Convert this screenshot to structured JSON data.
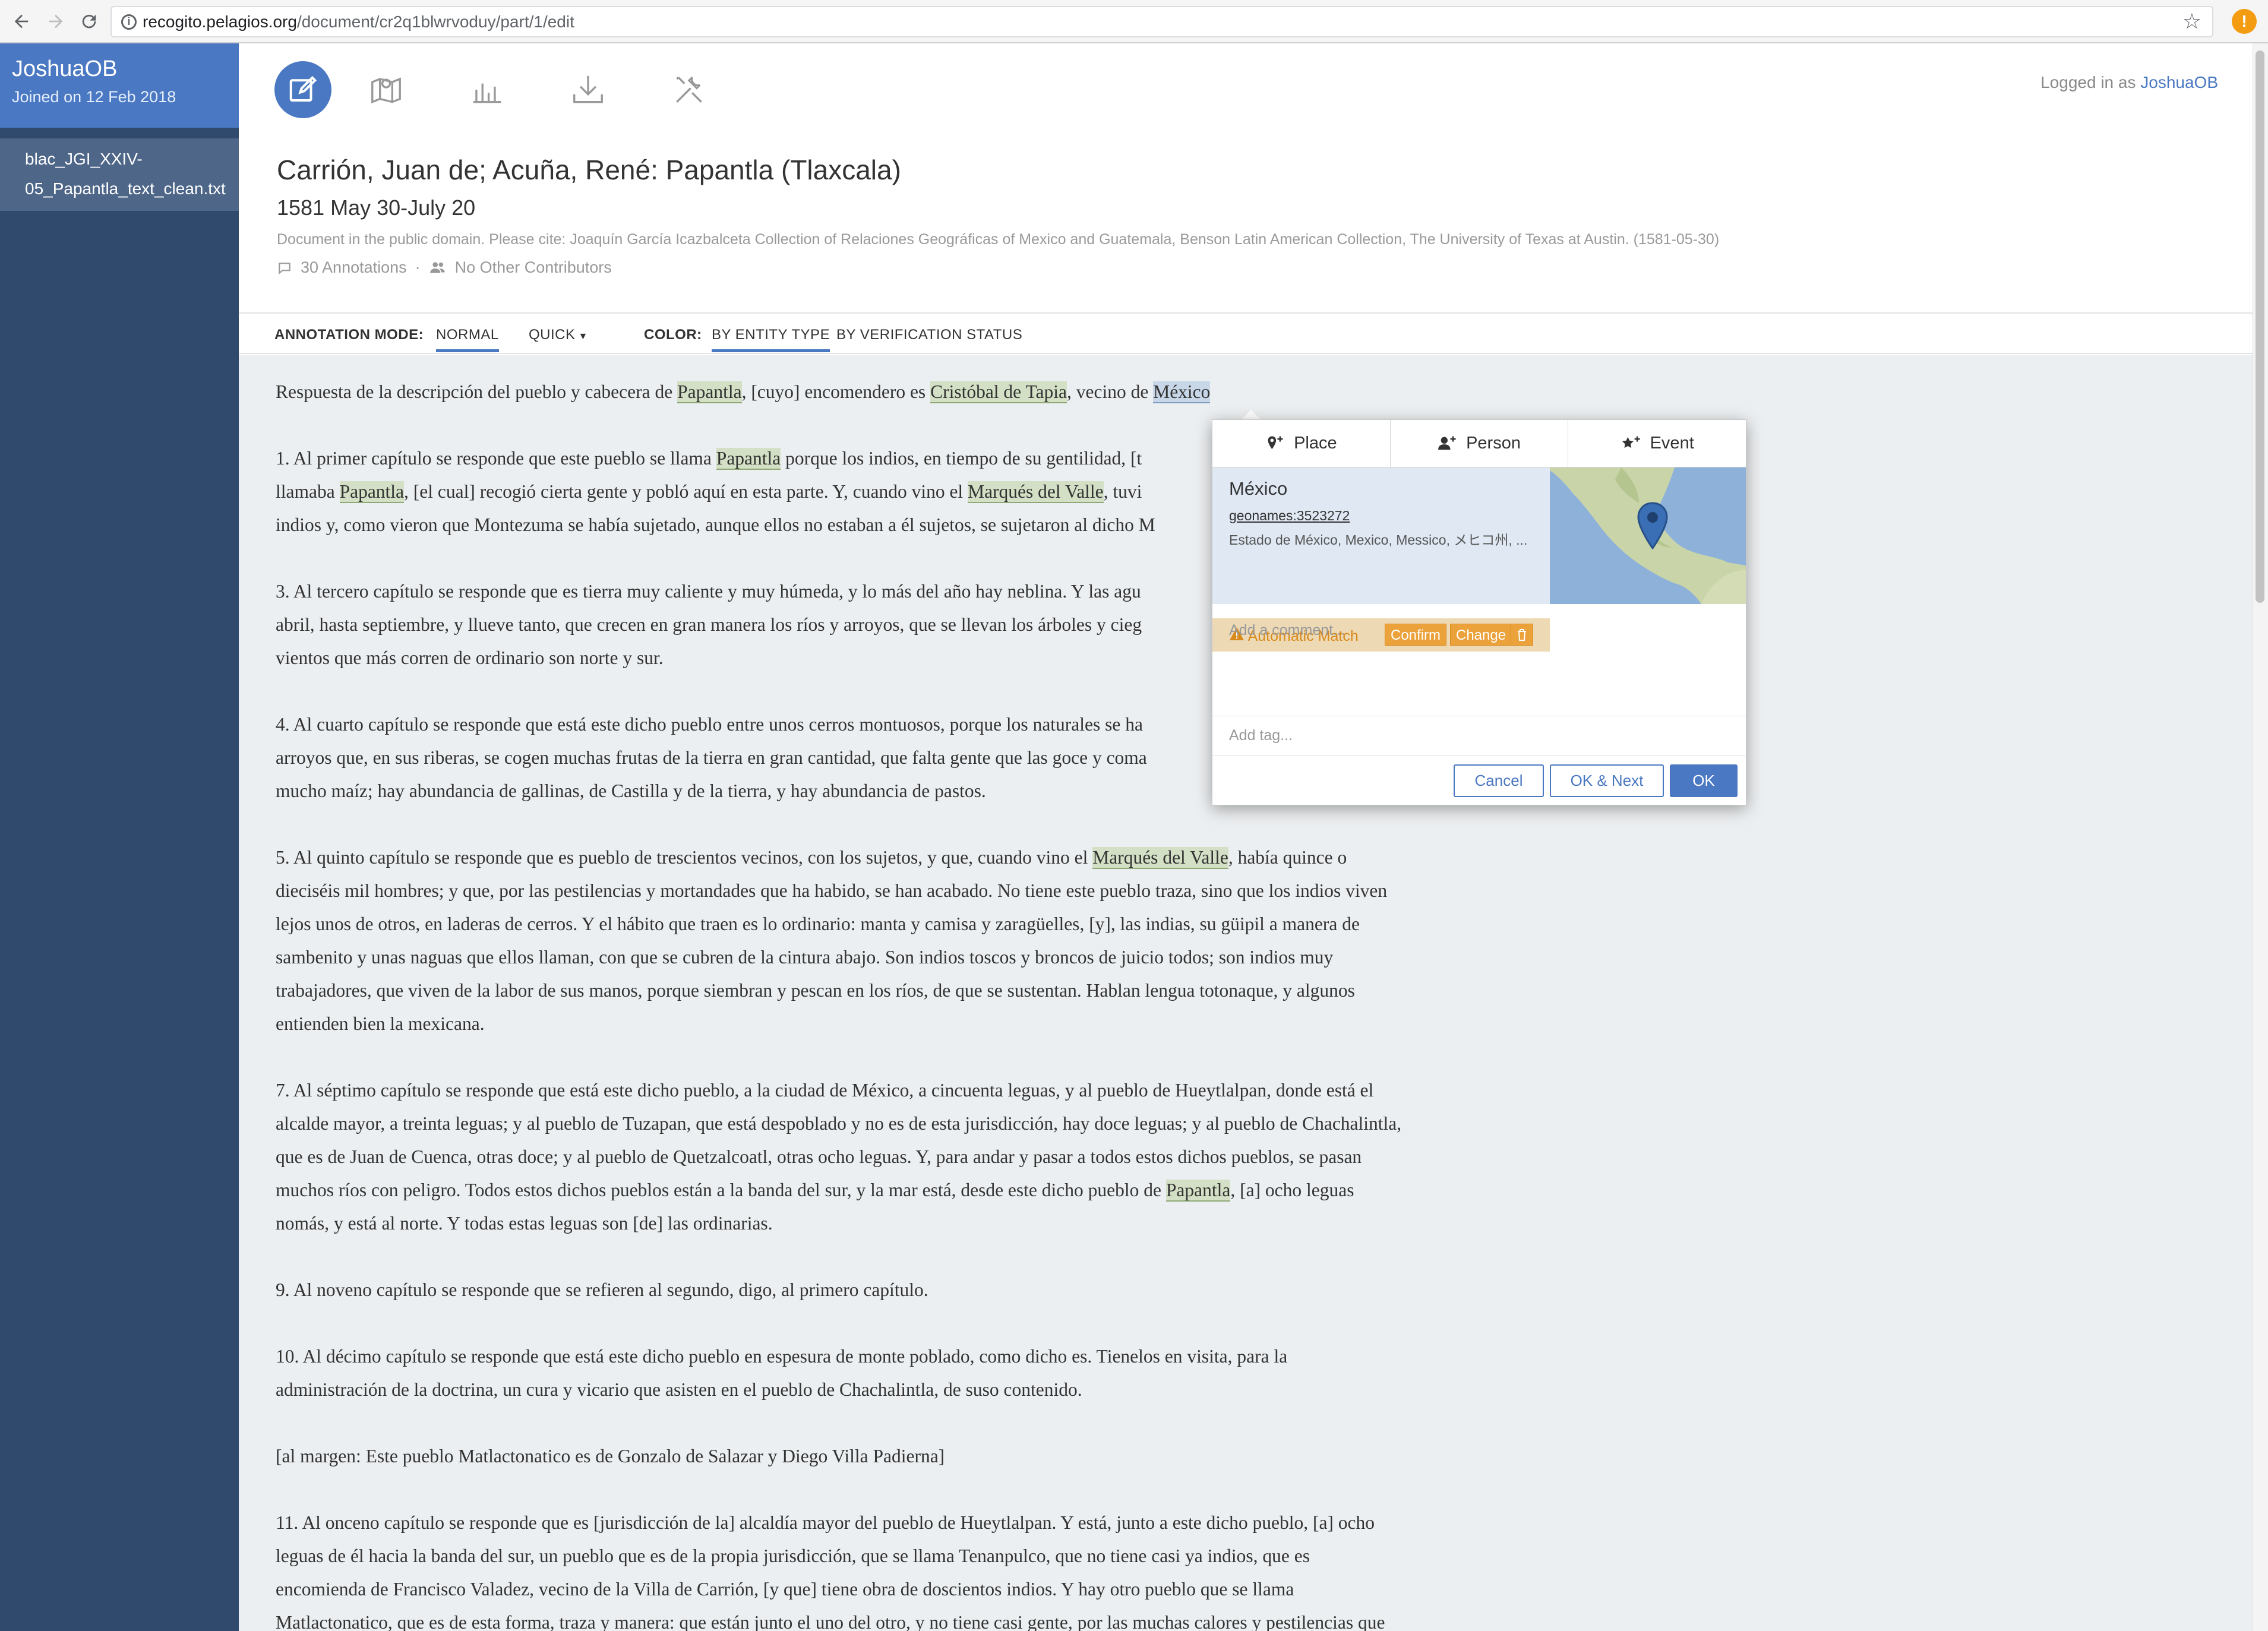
{
  "browser": {
    "url_host": "recogito.pelagios.org",
    "url_path": "/document/cr2q1blwrvoduy/part/1/edit",
    "back_icon": "arrow-left-icon",
    "forward_icon": "arrow-right-icon",
    "reload_icon": "reload-icon",
    "bookmark_icon": "star-icon",
    "extension_icon": "alert-icon",
    "extension_glyph": "!"
  },
  "sidebar": {
    "user_name": "JoshuaOB",
    "joined": "Joined on 12 Feb 2018",
    "documents": [
      {
        "line1": "blac_JGI_XXIV-",
        "line2": "05_Papantla_text_clean.txt"
      }
    ]
  },
  "header": {
    "tools": [
      "edit-icon",
      "map-icon",
      "stats-icon",
      "download-icon",
      "settings-icon"
    ],
    "logged_in_prefix": "Logged in as",
    "logged_in_user": "JoshuaOB",
    "title": "Carrión, Juan de; Acuña, René: Papantla (Tlaxcala)",
    "date": "1581 May 30-July 20",
    "citation": "Document in the public domain. Please cite: Joaquín García Icazbalceta Collection of Relaciones Geográficas of Mexico and Guatemala, Benson Latin American Collection, The University of Texas at Austin. (1581-05-30)",
    "annotations": "30 Annotations",
    "separator": "·",
    "contributors": "No Other Contributors"
  },
  "toolbar": {
    "mode_label": "ANNOTATION MODE:",
    "mode_normal": "NORMAL",
    "mode_quick": "QUICK",
    "color_label": "COLOR:",
    "color_entity": "BY ENTITY TYPE",
    "color_verification": "BY VERIFICATION STATUS"
  },
  "text": {
    "p0": [
      "Respuesta de la descripción del pueblo y cabecera de ",
      "Papantla",
      ", [cuyo] encomendero es ",
      "Cristóbal de Tapia",
      ", vecino de ",
      "México"
    ],
    "p1a": [
      "1. Al primer capítulo se responde que este pueblo se llama ",
      "Papantla",
      " porque los indios, en tiempo de su gentilidad, [t"
    ],
    "p1b": [
      "llamaba ",
      "Papantla",
      ", [el cual] recogió cierta gente y pobló aquí en esta parte. Y, cuando vino el ",
      "Marqués del Valle",
      ", tuvi"
    ],
    "p1c": "indios y, como vieron que Montezuma se había sujetado, aunque ellos no estaban a él sujetos, se sujetaron al dicho M",
    "p3": [
      "3. Al tercero capítulo se responde que es tierra muy caliente y muy húmeda, y lo más del año hay neblina. Y las agu",
      "abril, hasta septiembre, y llueve tanto, que crecen en gran manera los ríos y arroyos, que se llevan los árboles y cieg",
      "vientos que más corren de ordinario son norte y sur."
    ],
    "p4": [
      "4. Al cuarto capítulo se responde que está este dicho pueblo entre unos cerros montuosos, porque los naturales se ha",
      "arroyos que, en sus riberas, se cogen muchas frutas de la tierra en gran cantidad, que falta gente que las goce y coma",
      "mucho maíz; hay abundancia de gallinas, de Castilla y de la tierra, y hay abundancia de pastos."
    ],
    "p5a": [
      "5. Al quinto capítulo se responde que es pueblo de trescientos vecinos, con los sujetos, y que, cuando vino el ",
      "Marqués del Valle",
      ", había quince o"
    ],
    "p5": [
      "dieciséis mil hombres; y que, por las pestilencias y mortandades que ha habido, se han acabado. No tiene este pueblo traza, sino que los indios viven",
      "lejos unos de otros, en laderas de cerros. Y el hábito que traen es lo ordinario: manta y camisa y zaragüelles, [y], las indias, su güipil a manera de",
      "sambenito y unas naguas que ellos llaman, con que se cubren de la cintura abajo. Son indios toscos y broncos de juicio todos; son indios muy",
      "trabajadores, que viven de la labor de sus manos, porque siembran y pescan en los ríos, de que se sustentan. Hablan lengua totonaque, y algunos",
      "entienden bien la mexicana."
    ],
    "p7": [
      "7. Al séptimo capítulo se responde que está este dicho pueblo, a la ciudad de México, a cincuenta leguas, y al pueblo de Hueytlalpan, donde está el",
      "alcalde mayor, a treinta leguas; y al pueblo de Tuzapan, que está despoblado y no es de esta jurisdicción, hay doce leguas; y al pueblo de Chachalintla,",
      "que es de Juan de Cuenca, otras doce; y al pueblo de Quetzalcoatl, otras ocho leguas. Y, para andar y pasar a todos estos dichos pueblos, se pasan"
    ],
    "p7d": [
      "muchos ríos con peligro. Todos estos dichos pueblos están a la banda del sur, y la mar está, desde este dicho pueblo de ",
      "Papantla",
      ", [a] ocho leguas"
    ],
    "p7e": "nomás, y está al norte. Y todas estas leguas son [de] las ordinarias.",
    "p9": "9. Al noveno capítulo se responde que se refieren al segundo, digo, al primero capítulo.",
    "p10": [
      "10. Al décimo capítulo se responde que está este dicho pueblo en espesura de monte poblado, como dicho es. Tienelos en visita, para la",
      "administración de la doctrina, un cura y vicario que asisten en el pueblo de Chachalintla, de suso contenido."
    ],
    "margin": "[al margen: Este pueblo Matlactonatico es de Gonzalo de Salazar y Diego Villa Padierna]",
    "p11": [
      "11. Al onceno capítulo se responde que es [jurisdicción de la] alcaldía mayor del pueblo de Hueytlalpan. Y está, junto a este dicho pueblo, [a] ocho",
      "leguas de él hacia la banda del sur, un pueblo que es de la propia jurisdicción, que se llama Tenanpulco, que no tiene casi ya indios, que es",
      "encomienda de Francisco Valadez, vecino de la Villa de Carrión, [y que] tiene obra de doscientos indios. Y hay otro pueblo que se llama",
      "Matlactonatico, que es de esta forma, traza y manera: que están junto el uno del otro, y no tiene casi gente, por las muchas calores y pestilencias que"
    ]
  },
  "popup": {
    "tabs": [
      {
        "icon": "place-pin-icon",
        "label": "Place"
      },
      {
        "icon": "person-icon",
        "label": "Person"
      },
      {
        "icon": "event-star-icon",
        "label": "Event"
      }
    ],
    "match_name": "México",
    "match_uri": "geonames:3523272",
    "match_alt": "Estado de México, Mexico, Messico, メヒコ州, ...",
    "status": "Automatic Match",
    "status_icon": "warning-icon",
    "confirm": "Confirm",
    "change": "Change",
    "delete_icon": "trash-icon",
    "comment_placeholder": "Add a comment...",
    "tag_placeholder": "Add tag...",
    "cancel": "Cancel",
    "ok_next": "OK & Next",
    "ok": "OK"
  },
  "colors": {
    "accent": "#4a78c2",
    "sidebar": "#2f4a6d",
    "highlight_place": "#d3e0c5",
    "highlight_selected": "#c8d7e8",
    "warning": "#eca23b"
  }
}
